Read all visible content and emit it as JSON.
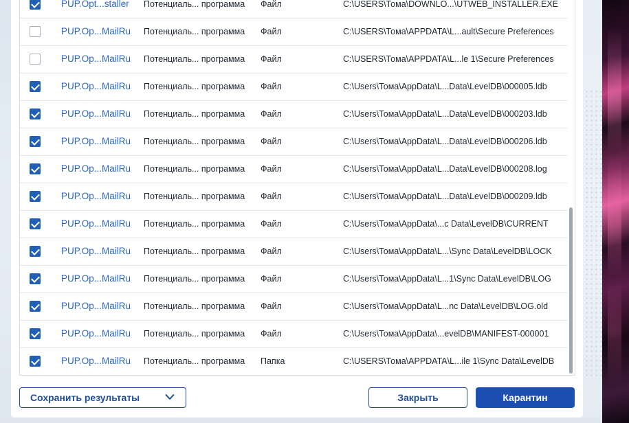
{
  "rows": [
    {
      "checked": true,
      "name": "PUP.Opt...staller",
      "type": "Потенциаль... программа",
      "kind": "Файл",
      "path": "C:\\USERS\\Тома\\DOWNLO...\\UTWEB_INSTALLER.EXE"
    },
    {
      "checked": false,
      "name": "PUP.Op...MailRu",
      "type": "Потенциаль... программа",
      "kind": "Файл",
      "path": "C:\\USERS\\Тома\\APPDATA\\L...ault\\Secure Preferences"
    },
    {
      "checked": false,
      "name": "PUP.Op...MailRu",
      "type": "Потенциаль... программа",
      "kind": "Файл",
      "path": "C:\\USERS\\Тома\\APPDATA\\L...le 1\\Secure Preferences"
    },
    {
      "checked": true,
      "name": "PUP.Op...MailRu",
      "type": "Потенциаль... программа",
      "kind": "Файл",
      "path": "C:\\Users\\Тома\\AppData\\L...Data\\LevelDB\\000005.ldb"
    },
    {
      "checked": true,
      "name": "PUP.Op...MailRu",
      "type": "Потенциаль... программа",
      "kind": "Файл",
      "path": "C:\\Users\\Тома\\AppData\\L...Data\\LevelDB\\000203.ldb"
    },
    {
      "checked": true,
      "name": "PUP.Op...MailRu",
      "type": "Потенциаль... программа",
      "kind": "Файл",
      "path": "C:\\Users\\Тома\\AppData\\L...Data\\LevelDB\\000206.ldb"
    },
    {
      "checked": true,
      "name": "PUP.Op...MailRu",
      "type": "Потенциаль... программа",
      "kind": "Файл",
      "path": "C:\\Users\\Тома\\AppData\\L...Data\\LevelDB\\000208.log"
    },
    {
      "checked": true,
      "name": "PUP.Op...MailRu",
      "type": "Потенциаль... программа",
      "kind": "Файл",
      "path": "C:\\Users\\Тома\\AppData\\L...Data\\LevelDB\\000209.ldb"
    },
    {
      "checked": true,
      "name": "PUP.Op...MailRu",
      "type": "Потенциаль... программа",
      "kind": "Файл",
      "path": "C:\\Users\\Тома\\AppData\\...c Data\\LevelDB\\CURRENT"
    },
    {
      "checked": true,
      "name": "PUP.Op...MailRu",
      "type": "Потенциаль... программа",
      "kind": "Файл",
      "path": "C:\\Users\\Тома\\AppData\\L...\\Sync Data\\LevelDB\\LOCK"
    },
    {
      "checked": true,
      "name": "PUP.Op...MailRu",
      "type": "Потенциаль... программа",
      "kind": "Файл",
      "path": "C:\\Users\\Тома\\AppData\\L...1\\Sync Data\\LevelDB\\LOG"
    },
    {
      "checked": true,
      "name": "PUP.Op...MailRu",
      "type": "Потенциаль... программа",
      "kind": "Файл",
      "path": "C:\\Users\\Тома\\AppData\\L...nc Data\\LevelDB\\LOG.old"
    },
    {
      "checked": true,
      "name": "PUP.Op...MailRu",
      "type": "Потенциаль... программа",
      "kind": "Файл",
      "path": "C:\\Users\\Тома\\AppData\\...evelDB\\MANIFEST-000001"
    },
    {
      "checked": true,
      "name": "PUP.Op...MailRu",
      "type": "Потенциаль... программа",
      "kind": "Папка",
      "path": "C:\\USERS\\Тома\\APPDATA\\L...ile 1\\Sync Data\\LevelDB"
    }
  ],
  "buttons": {
    "save_results": "Сохранить результаты",
    "close": "Закрыть",
    "quarantine": "Карантин"
  },
  "colors": {
    "accent": "#1d4fb2",
    "threat_name": "#2a66c9",
    "checkbox": "#1f5fb8"
  },
  "icons": {
    "save_dropdown": "chevron-down-icon"
  }
}
